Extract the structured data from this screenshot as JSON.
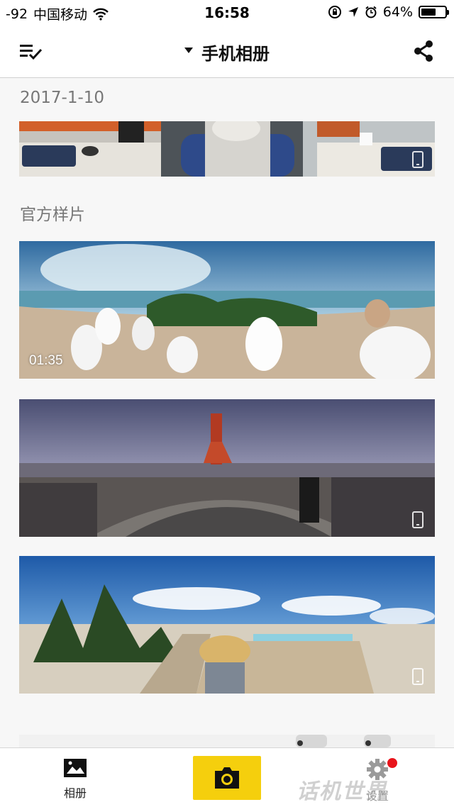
{
  "status_bar": {
    "signal": "-92",
    "carrier": "中国移动",
    "time": "16:58",
    "battery_percent": "64%",
    "battery_level": 0.64
  },
  "header": {
    "title": "手机相册",
    "select_icon": "list-check-icon",
    "share_icon": "share-icon"
  },
  "sections": [
    {
      "label": "2017-1-10",
      "items": [
        {
          "type": "photo",
          "badge": "phone-icon"
        }
      ]
    },
    {
      "label": "官方样片",
      "items": [
        {
          "type": "video",
          "duration": "01:35"
        },
        {
          "type": "photo",
          "badge": "phone-icon"
        },
        {
          "type": "photo",
          "badge": "phone-icon"
        },
        {
          "type": "photo"
        }
      ]
    }
  ],
  "tabs": {
    "album_label": "相册",
    "settings_label": "设置",
    "camera_icon": "camera-icon",
    "accent": "#f5cf0d",
    "notification_color": "#e8141b"
  },
  "watermark": "话机世界"
}
